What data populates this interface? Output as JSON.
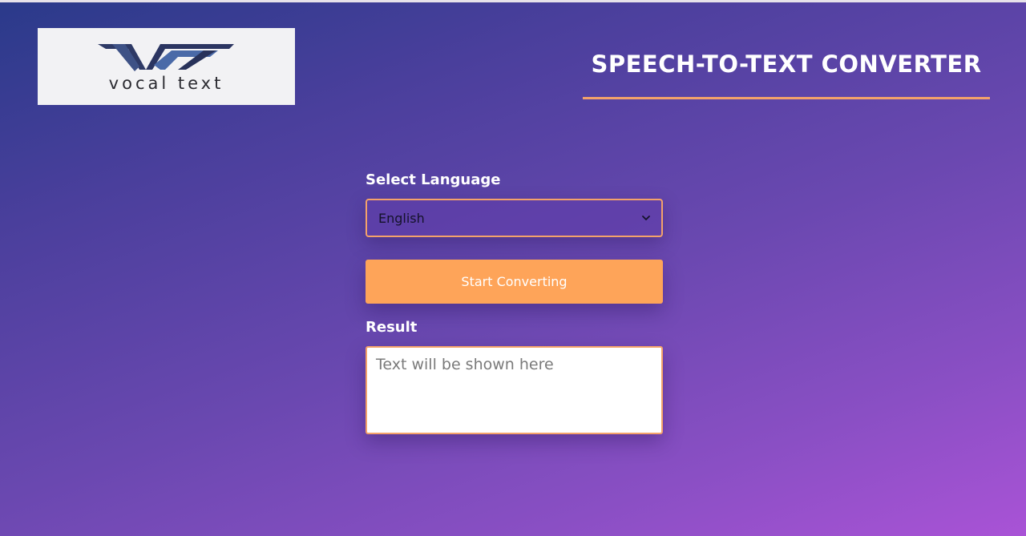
{
  "logo": {
    "text": "vocal text",
    "icon": "v-logo-mark"
  },
  "header": {
    "title": "SPEECH-TO-TEXT CONVERTER"
  },
  "language": {
    "label": "Select Language",
    "selected": "English"
  },
  "convert": {
    "button_label": "Start Converting"
  },
  "result": {
    "label": "Result",
    "placeholder": "Text will be shown here",
    "value": ""
  },
  "colors": {
    "accent": "#fea459",
    "border_accent": "#f4a26a",
    "gradient_start": "#2a3a8a",
    "gradient_end": "#a953d6"
  }
}
